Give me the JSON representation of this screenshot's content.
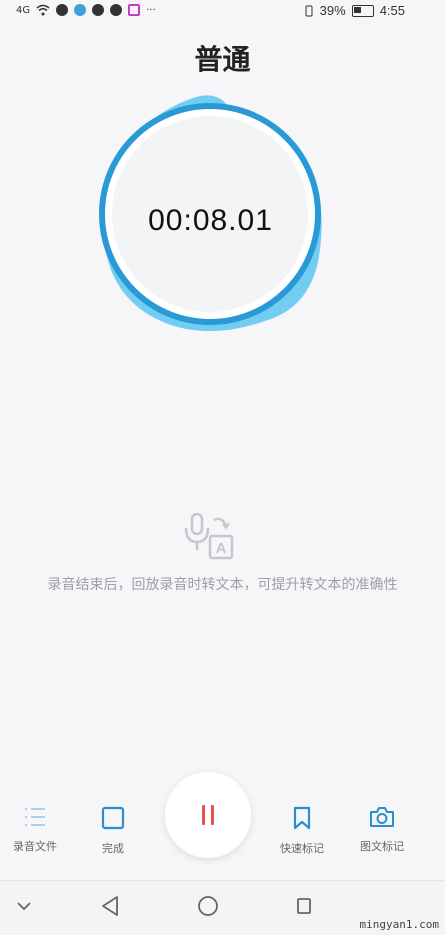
{
  "status_bar": {
    "signal_label": "4G",
    "more_label": "···",
    "battery_percent": "39%",
    "time": "4:55",
    "icons": [
      "signal-icon",
      "wifi-icon",
      "app-icon",
      "app-icon",
      "app-icon",
      "app-icon",
      "app-icon"
    ]
  },
  "header": {
    "title": "普通"
  },
  "recorder": {
    "elapsed": "00:08.01",
    "accent_color": "#2aa3e0",
    "state": "recording"
  },
  "hint": {
    "text": "录音结束后，回放录音时转文本，可提升转文本的准确性"
  },
  "toolbar": {
    "files_label": "录音文件",
    "done_label": "完成",
    "quick_mark_label": "快速标记",
    "photo_mark_label": "图文标记",
    "pause_color": "#e5534b"
  },
  "nav": {
    "icons": [
      "chevron-down-icon",
      "back-icon",
      "home-icon",
      "recent-icon"
    ]
  },
  "watermark": {
    "text": "mingyan1.com"
  }
}
